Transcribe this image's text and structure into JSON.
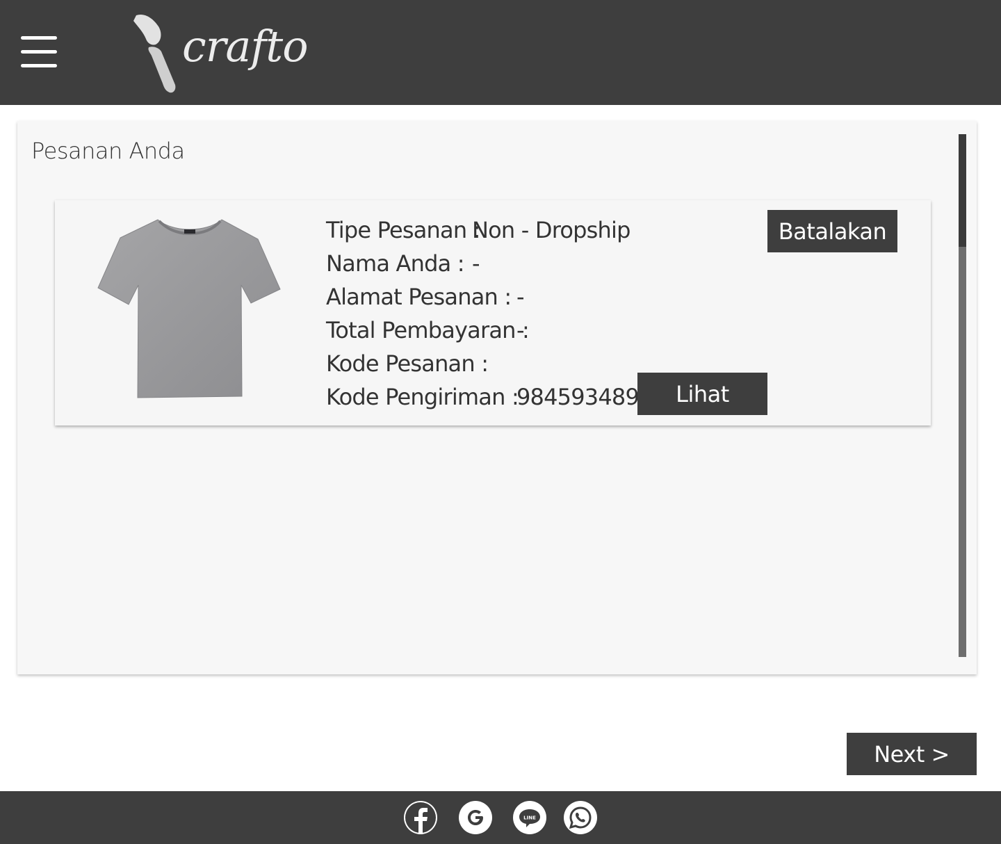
{
  "header": {
    "menu_icon": "hamburger-menu-icon",
    "logo_text": "crafto",
    "logo_icon": "paintbrush-icon"
  },
  "panel": {
    "title": "Pesanan Anda"
  },
  "order": {
    "product_image": "grey-tshirt-image",
    "rows": [
      {
        "label": "Tipe Pesanan :",
        "value": "Non - Dropship"
      },
      {
        "label": "Nama Anda :",
        "value": "-"
      },
      {
        "label": "Alamat Pesanan :",
        "value": "-"
      },
      {
        "label": "Total Pembayaran :",
        "value": "-"
      },
      {
        "label": "Kode Pesanan :",
        "value": ""
      },
      {
        "label": "Kode Pengiriman :",
        "value": "984593489"
      }
    ],
    "cancel_label": "Batalakan",
    "view_label": "Lihat"
  },
  "pagination": {
    "next_label": "Next >"
  },
  "footer": {
    "social": [
      "facebook-icon",
      "google-icon",
      "line-icon",
      "whatsapp-icon"
    ],
    "line_text": "LINE"
  },
  "colors": {
    "header_bg": "#3e3e3e",
    "button_bg": "#3e3e3e",
    "panel_bg": "#f7f7f7"
  }
}
